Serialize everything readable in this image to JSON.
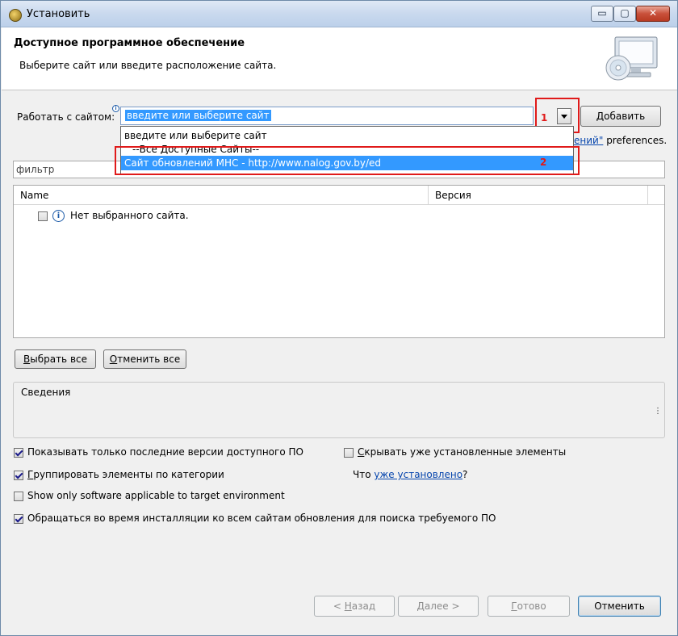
{
  "window": {
    "title": "Установить",
    "controls": {
      "minimize": "▭",
      "maximize": "▢",
      "close": "✕"
    }
  },
  "header": {
    "title": "Доступное программное обеспечение",
    "subtitle": "Выберите сайт или введите расположение сайта."
  },
  "site": {
    "label": "Работать с сайтом:",
    "value": "введите или выберите сайт",
    "add_button": "Добавить",
    "add_mnemonic": "Д",
    "add_rest": "обавить",
    "annotation_dropdown": "1",
    "link_partial": "ений\"",
    "preferences_text": "preferences."
  },
  "dropdown": {
    "items": [
      "введите или выберите сайт",
      "--Все Доступные Сайты--",
      "Сайт обновлений МНС - http://www.nalog.gov.by/ed"
    ],
    "highlighted_index": 2,
    "annotation_item": "2"
  },
  "filter": {
    "placeholder": "фильтр"
  },
  "table": {
    "columns": [
      "Name",
      "Версия",
      ""
    ],
    "rows": [
      {
        "label": "Нет выбранного сайта.",
        "checked": false,
        "icon": "info-icon"
      }
    ]
  },
  "buttons": {
    "select_all_m": "В",
    "select_all_r": "ыбрать все",
    "deselect_all_m": "О",
    "deselect_all_r": "тменить все"
  },
  "details": {
    "title": "Сведения",
    "scroll_glyph": "⋮"
  },
  "options": {
    "show_latest": {
      "label": "Показывать только последние версии доступного ПО",
      "checked": true
    },
    "hide_installed": {
      "mnemonic": "С",
      "rest": "крывать уже установленные элементы",
      "checked": false
    },
    "group_by_category": {
      "mnemonic": "Г",
      "rest": "руппировать элементы по категории",
      "checked": true
    },
    "what_installed_prefix": "Что",
    "what_installed_link": "уже установлено",
    "what_installed_suffix": "?",
    "target_env": {
      "label": "Show only software applicable to target environment",
      "checked": false
    },
    "contact_all": {
      "label": "Обращаться во время инсталляции ко всем сайтам обновления для поиска требуемого ПО",
      "checked": true
    }
  },
  "footer": {
    "back_prefix": "< ",
    "back_m": "Н",
    "back_rest": "азад",
    "next_m": "Д",
    "next_rest": "алее >",
    "finish_m": "Г",
    "finish_rest": "отово",
    "cancel": "Отменить"
  },
  "colors": {
    "selection": "#3399ff",
    "annotation_red": "#e01a1a",
    "link": "#0645ad"
  }
}
